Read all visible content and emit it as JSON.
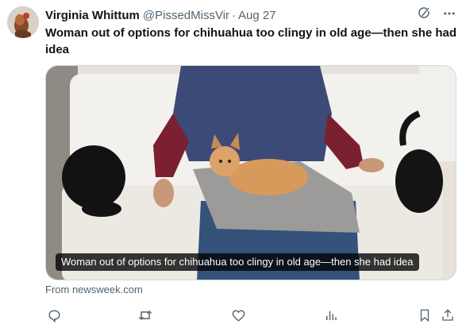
{
  "tweet": {
    "author_name": "Virginia Whittum",
    "author_handle": "@PissedMissVir",
    "separator": "·",
    "date": "Aug 27",
    "text": "Woman out of options for chihuahua too clingy in old age—then she had idea"
  },
  "media": {
    "caption": "Woman out of options for chihuahua too clingy in old age—then she had idea"
  },
  "card": {
    "source": "From newsweek.com"
  },
  "icons": {
    "grok": "grok-icon",
    "more": "more-icon",
    "reply": "reply-icon",
    "retweet": "retweet-icon",
    "like": "like-icon",
    "views": "views-icon",
    "bookmark": "bookmark-icon",
    "share": "share-icon"
  },
  "colors": {
    "text": "#0f1419",
    "secondary": "#536471",
    "border": "#cfd9de"
  }
}
